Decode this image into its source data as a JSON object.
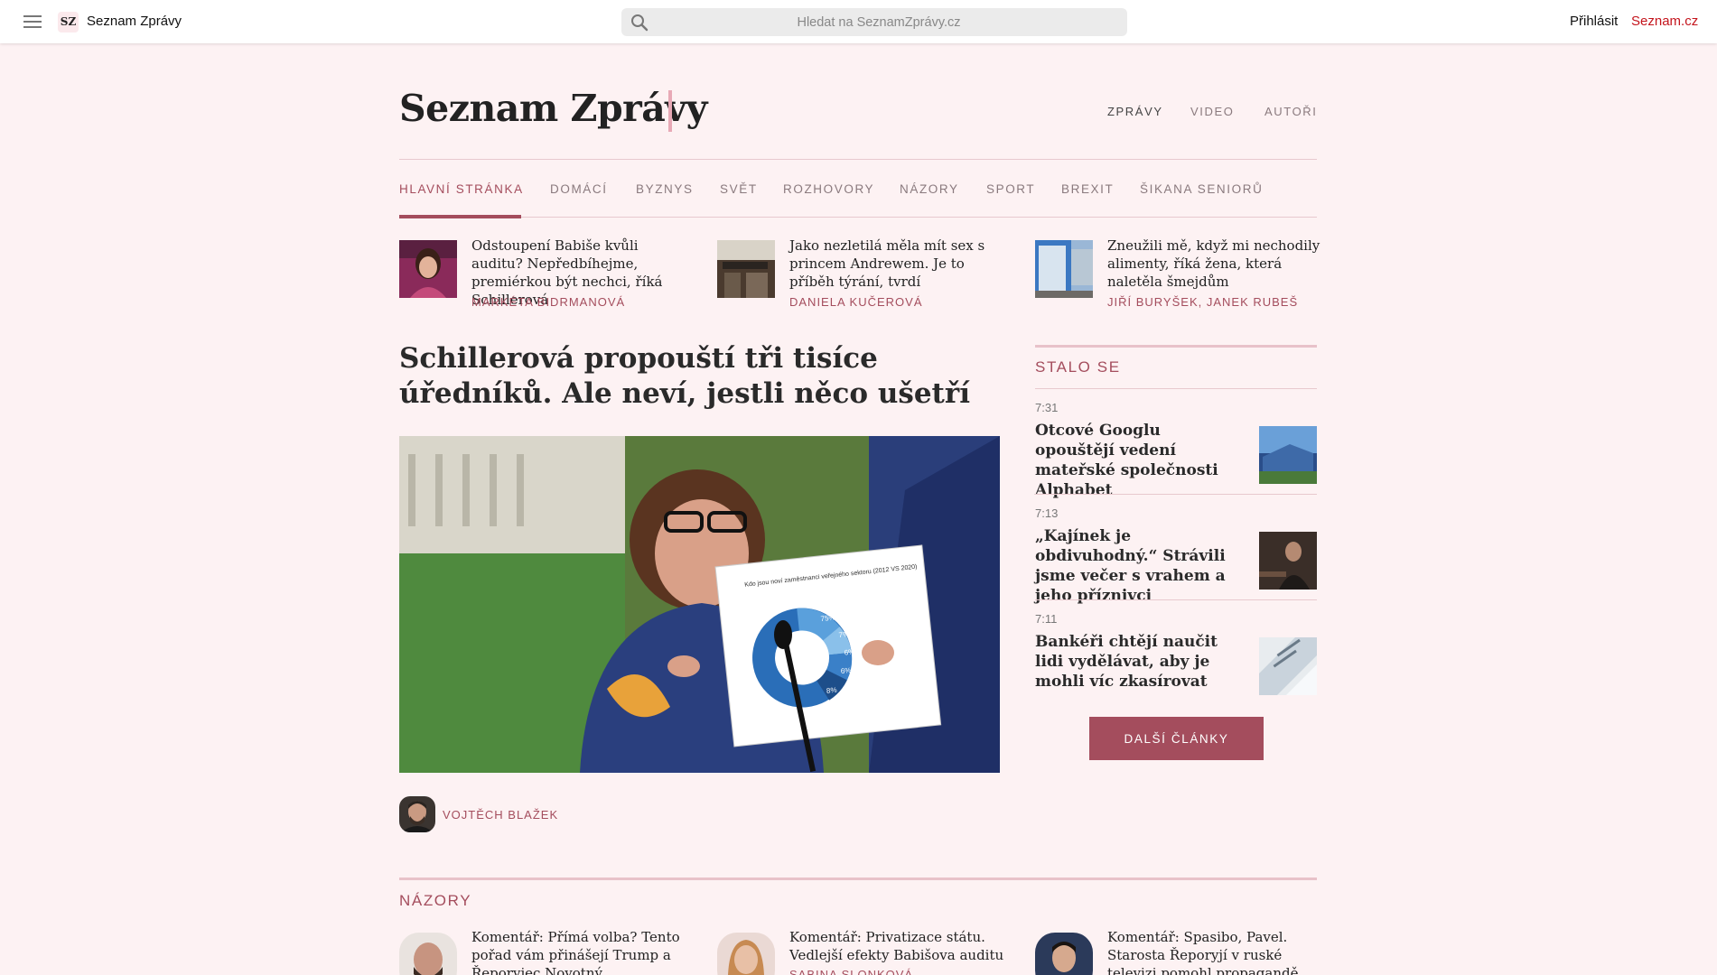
{
  "topbar": {
    "logo_badge": "SZ",
    "logo_text": "Seznam Zprávy",
    "search_placeholder": "Hledat na SeznamZprávy.cz",
    "login": "Přihlásit",
    "seznam_link": "Seznam.cz"
  },
  "masthead": {
    "title": "Seznam Zprávy",
    "sections": [
      "ZPRÁVY",
      "VIDEO",
      "AUTOŘI"
    ]
  },
  "categories": [
    "HLAVNÍ STRÁNKA",
    "DOMÁCÍ",
    "BYZNYS",
    "SVĚT",
    "ROZHOVORY",
    "NÁZORY",
    "SPORT",
    "BREXIT",
    "ŠIKANA SENIORŮ"
  ],
  "top_teasers": [
    {
      "title": "Odstoupení Babiše kvůli auditu? Nepředbíhejme, premiérkou být nechci, říká Schillerová",
      "author": "MARKÉTA BIDRMANOVÁ"
    },
    {
      "title": "Jako nezletilá měla mít sex s princem Andrewem. Je to příběh týrání, tvrdí",
      "author": "DANIELA KUČEROVÁ"
    },
    {
      "title": "Zneužili mě, když mi nechodily alimenty, říká žena, která naletěla šmejdům",
      "author": "JIŘÍ BURYŠEK, JANEK RUBEŠ"
    }
  ],
  "main_article": {
    "headline": "Schillerová propouští tři tisíce úředníků. Ale neví, jestli něco ušetří",
    "author": "VOJTĚCH BLAŽEK",
    "chart_caption": "Kdo jsou noví zaměstnanci veřejného sektoru (2012 VS 2020)",
    "chart_labels": [
      "75%",
      "7%",
      "6%",
      "6%",
      "8%"
    ]
  },
  "stalo_se": {
    "label": "STALO SE",
    "items": [
      {
        "time": "7:31",
        "title": "Otcové Googlu opouštějí vedení mateřské společnosti Alphabet"
      },
      {
        "time": "7:13",
        "title": "„Kajínek je obdivuhodný.“ Strávili jsme večer s vrahem a jeho příznivci"
      },
      {
        "time": "7:11",
        "title": "Bankéři chtějí naučit lidi vydělávat, aby je mohli víc zkasírovat"
      }
    ],
    "more_button": "DALŠÍ ČLÁNKY"
  },
  "nazory": {
    "label": "NÁZORY",
    "items": [
      {
        "title": "Komentář: Přímá volba? Tento pořad vám přinášejí Trump a Řeporyjec Novotný"
      },
      {
        "title": "Komentář: Privatizace státu. Vedlejší efekty Babišova auditu"
      },
      {
        "title": "Komentář: Spasibo, Pavel. Starosta Řeporyjí v ruské televizi pomohl propagandě"
      }
    ],
    "partial_author": "SABINA SLONKOVÁ"
  },
  "colors": {
    "accent": "#a44d5d",
    "background": "#fdf2f3",
    "brand_red": "#c4141c"
  }
}
